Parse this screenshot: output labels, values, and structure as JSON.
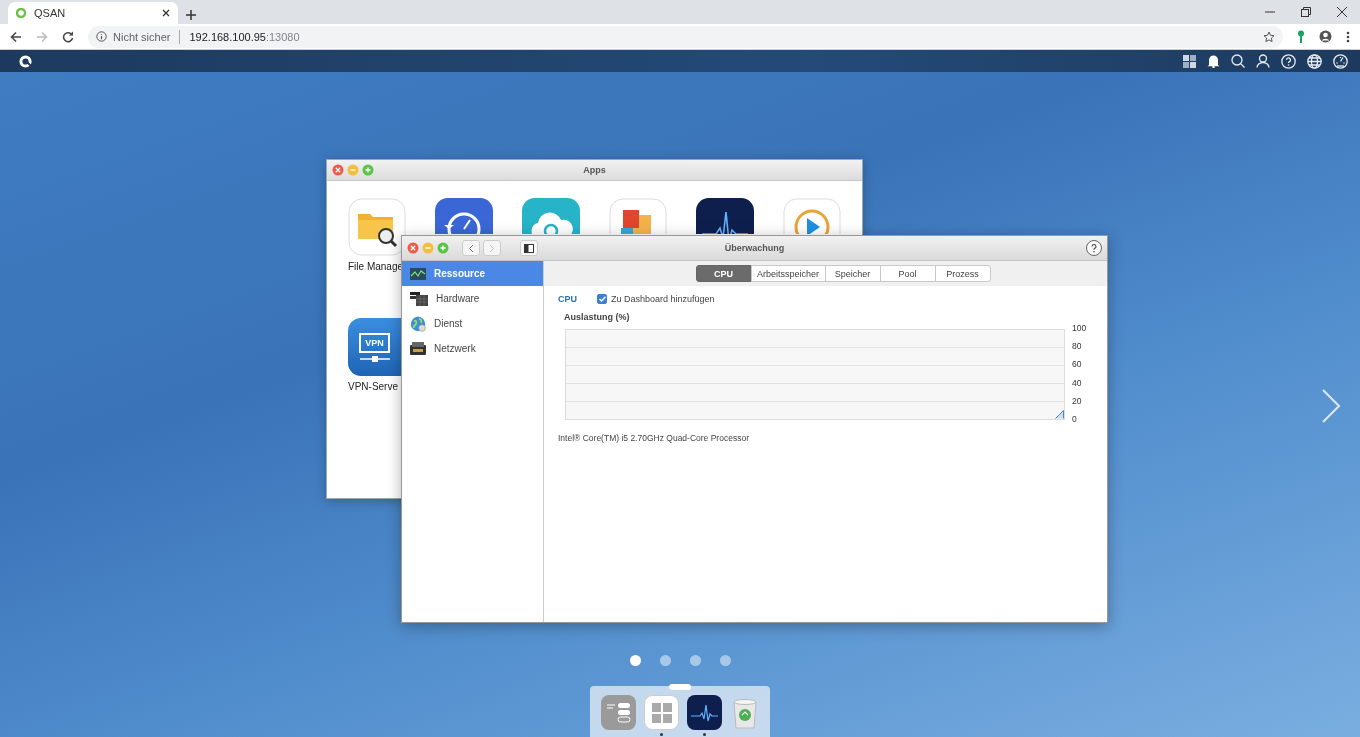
{
  "browser": {
    "tab_title": "QSAN",
    "url_security": "Nicht sicher",
    "url_host": "192.168.100.95",
    "url_port": ":13080"
  },
  "apps_window": {
    "title": "Apps",
    "apps": [
      {
        "kind": "file-manager",
        "label": "File Manage"
      },
      {
        "kind": "backup"
      },
      {
        "kind": "cloud-sync"
      },
      {
        "kind": "storage"
      },
      {
        "kind": "monitor"
      },
      {
        "kind": "media"
      },
      {
        "kind": "vpn",
        "label": "VPN-Serve",
        "badge": "VPN"
      }
    ]
  },
  "monitor_window": {
    "title": "Überwachung",
    "sidebar": [
      {
        "kind": "resource",
        "label": "Ressource",
        "selected": true
      },
      {
        "kind": "hardware",
        "label": "Hardware",
        "selected": false
      },
      {
        "kind": "service",
        "label": "Dienst",
        "selected": false
      },
      {
        "kind": "network",
        "label": "Netzwerk",
        "selected": false
      }
    ],
    "tabs": [
      {
        "label": "CPU",
        "selected": true
      },
      {
        "label": "Arbeitsspeicher",
        "selected": false
      },
      {
        "label": "Speicher",
        "selected": false
      },
      {
        "label": "Pool",
        "selected": false
      },
      {
        "label": "Prozess",
        "selected": false
      }
    ],
    "section_title": "CPU",
    "dashboard_checkbox": {
      "label": "Zu Dashboard hinzufügen",
      "checked": true
    },
    "chart_title": "Auslastung (%)",
    "y_ticks": [
      "100",
      "80",
      "60",
      "40",
      "20",
      "0"
    ],
    "processor": "Intel® Core(TM) i5 2.70GHz Quad-Core Processor"
  },
  "page_dots": [
    {
      "selected": true
    },
    {
      "selected": false
    },
    {
      "selected": false
    },
    {
      "selected": false
    }
  ],
  "dock": [
    {
      "kind": "control-panel",
      "running": false
    },
    {
      "kind": "apps",
      "running": true
    },
    {
      "kind": "monitor",
      "running": true
    },
    {
      "kind": "trash",
      "running": false
    }
  ]
}
